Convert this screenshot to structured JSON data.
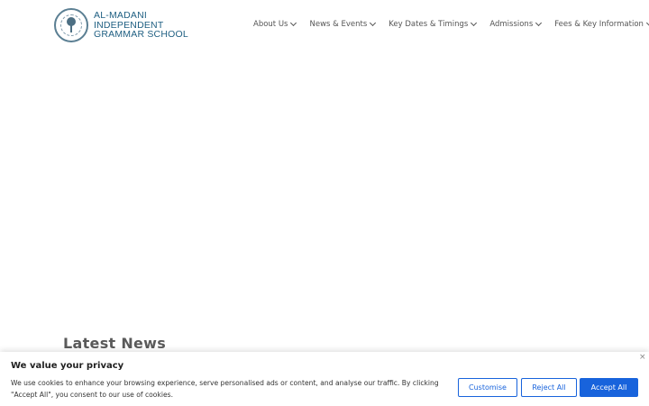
{
  "logo": {
    "line1": "AL-MADANI",
    "line2": "INDEPENDENT",
    "line3": "GRAMMAR SCHOOL"
  },
  "nav": {
    "items": [
      {
        "label": "About Us"
      },
      {
        "label": "News & Events"
      },
      {
        "label": "Key Dates & Timings"
      },
      {
        "label": "Admissions"
      },
      {
        "label": "Fees & Key Information"
      }
    ]
  },
  "main": {
    "latest_news_heading": "Latest News"
  },
  "cookie_banner": {
    "title": "We value your privacy",
    "description": "We use cookies to enhance your browsing experience, serve personalised ads or content, and analyse our traffic. By clicking \"Accept All\", you consent to our use of cookies.",
    "close_glyph": "×",
    "customise_label": "Customise",
    "reject_label": "Reject All",
    "accept_label": "Accept All"
  },
  "colors": {
    "brand_blue": "#1f5f82",
    "button_blue": "#1863dc"
  }
}
